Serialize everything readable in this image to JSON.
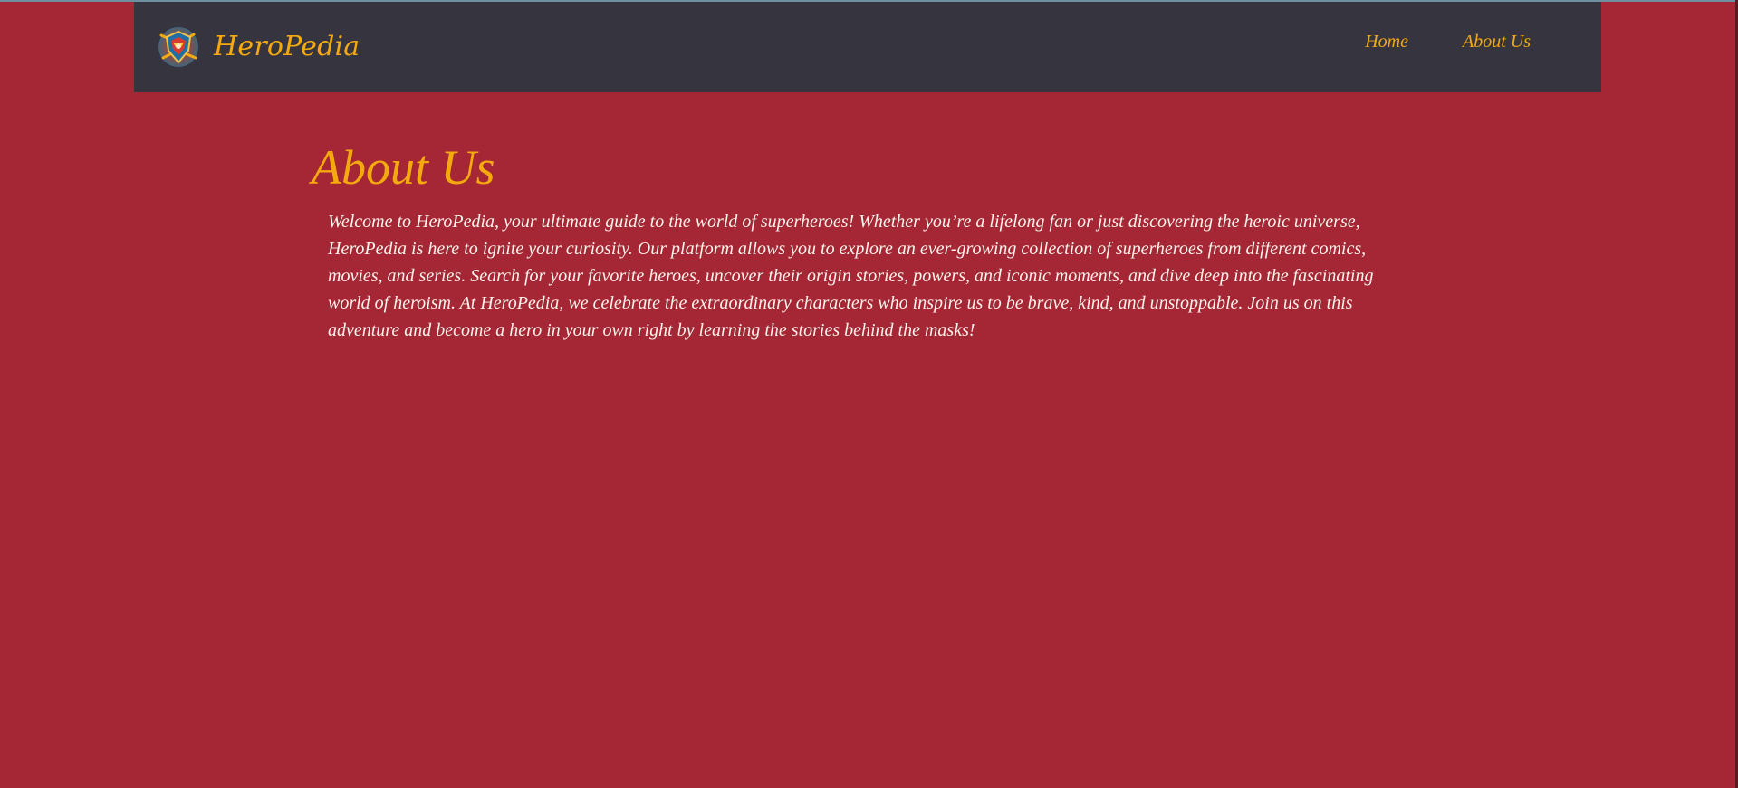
{
  "app": {
    "brand_name": "HeroPedia",
    "logo_icon": "hero-emblem-logo-icon"
  },
  "nav": {
    "items": [
      {
        "label": "Home"
      },
      {
        "label": "About Us"
      }
    ]
  },
  "main": {
    "title": "About Us",
    "body": "Welcome to HeroPedia, your ultimate guide to the world of superheroes! Whether you’re a lifelong fan or just discovering the heroic universe, HeroPedia is here to ignite your curiosity. Our platform allows you to explore an ever-growing collection of superheroes from different comics, movies, and series. Search for your favorite heroes, uncover their origin stories, powers, and iconic moments, and dive deep into the fascinating world of heroism. At HeroPedia, we celebrate the extraordinary characters who inspire us to be brave, kind, and unstoppable. Join us on this adventure and become a hero in your own right by learning the stories behind the masks!"
  },
  "colors": {
    "page_background": "#a52634",
    "navbar_background": "#35343f",
    "accent": "#f4aa0f",
    "body_text": "#f9f3eb"
  }
}
